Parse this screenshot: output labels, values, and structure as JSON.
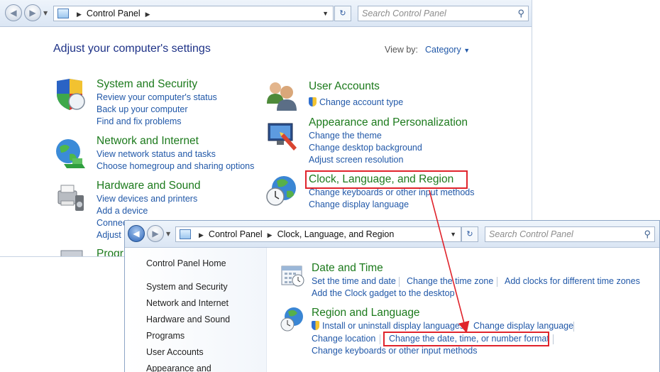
{
  "window1": {
    "address_label": "Control Panel",
    "search_placeholder": "Search Control Panel",
    "heading": "Adjust your computer's settings",
    "view_by_label": "View by:",
    "view_by_value": "Category",
    "categories": [
      {
        "title": "System and Security",
        "links": [
          "Review your computer's status",
          "Back up your computer",
          "Find and fix problems"
        ]
      },
      {
        "title": "Network and Internet",
        "links": [
          "View network status and tasks",
          "Choose homegroup and sharing options"
        ]
      },
      {
        "title": "Hardware and Sound",
        "links": [
          "View devices and printers",
          "Add a device",
          "Connect",
          "Adjust"
        ]
      },
      {
        "title": "Progr"
      },
      {
        "title": "User Accounts",
        "links": [
          "Change account type"
        ]
      },
      {
        "title": "Appearance and Personalization",
        "links": [
          "Change the theme",
          "Change desktop background",
          "Adjust screen resolution"
        ]
      },
      {
        "title": "Clock, Language, and Region",
        "links": [
          "Change keyboards or other input methods",
          "Change display language"
        ]
      }
    ]
  },
  "window2": {
    "address": [
      "Control Panel",
      "Clock, Language, and Region"
    ],
    "search_placeholder": "Search Control Panel",
    "nav": [
      "Control Panel Home",
      "System and Security",
      "Network and Internet",
      "Hardware and Sound",
      "Programs",
      "User Accounts",
      "Appearance and"
    ],
    "sections": [
      {
        "title": "Date and Time",
        "links": [
          "Set the time and date",
          "Change the time zone",
          "Add clocks for different time zones",
          "Add the Clock gadget to the desktop"
        ]
      },
      {
        "title": "Region and Language",
        "links": [
          "Install or uninstall display languages",
          "Change display language",
          "Change location",
          "Change the date, time, or number format",
          "Change keyboards or other input methods"
        ]
      }
    ]
  },
  "colors": {
    "highlight": "#e0242c",
    "link": "#2158a8",
    "category": "#1c7a1c"
  }
}
